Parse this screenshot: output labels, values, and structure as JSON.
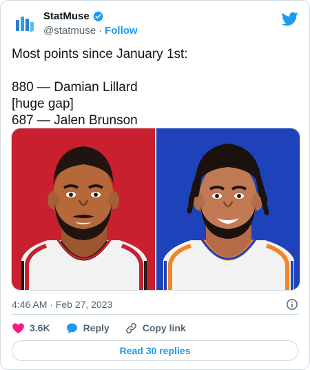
{
  "account": {
    "display_name": "StatMuse",
    "handle": "@statmuse",
    "separator": "·",
    "follow_label": "Follow"
  },
  "tweet": {
    "text": "Most points since January 1st:\n\n880 — Damian Lillard\n[huge gap]\n687 — Jalen Brunson",
    "timestamp": "4:46 AM · Feb 27, 2023"
  },
  "media": {
    "left_bg": "#c8202f",
    "right_bg": "#1d42ba"
  },
  "actions": {
    "like_count": "3.6K",
    "reply_label": "Reply",
    "copy_link_label": "Copy link"
  },
  "replies_button": "Read 30 replies",
  "colors": {
    "accent": "#1d9bf0",
    "like": "#f91880",
    "muted": "#536471"
  }
}
